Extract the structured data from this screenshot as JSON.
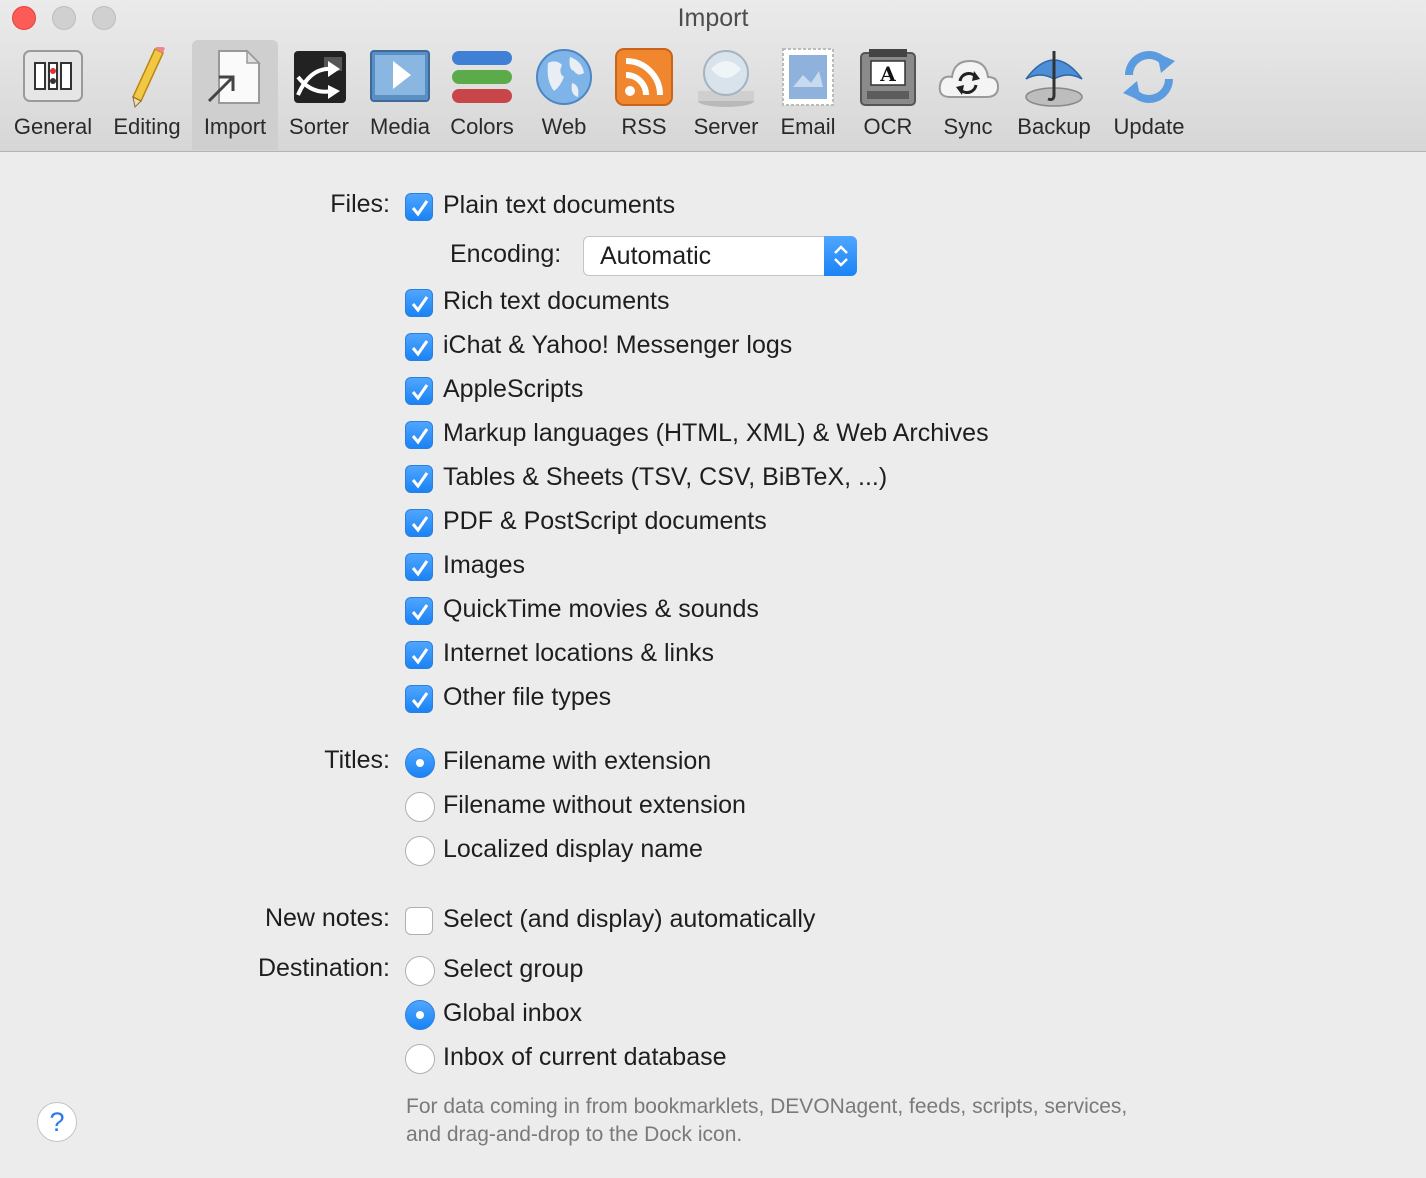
{
  "window": {
    "title": "Import"
  },
  "toolbar": {
    "selected": "Import",
    "items": [
      {
        "label": "General",
        "icon": "general-icon"
      },
      {
        "label": "Editing",
        "icon": "pencil-icon"
      },
      {
        "label": "Import",
        "icon": "import-document-icon"
      },
      {
        "label": "Sorter",
        "icon": "sorter-icon"
      },
      {
        "label": "Media",
        "icon": "media-play-icon"
      },
      {
        "label": "Colors",
        "icon": "colors-icon"
      },
      {
        "label": "Web",
        "icon": "globe-icon"
      },
      {
        "label": "RSS",
        "icon": "rss-icon"
      },
      {
        "label": "Server",
        "icon": "server-icon"
      },
      {
        "label": "Email",
        "icon": "stamp-icon"
      },
      {
        "label": "OCR",
        "icon": "scanner-icon"
      },
      {
        "label": "Sync",
        "icon": "cloud-sync-icon"
      },
      {
        "label": "Backup",
        "icon": "umbrella-icon"
      },
      {
        "label": "Update",
        "icon": "update-arrows-icon"
      }
    ]
  },
  "files": {
    "label": "Files:",
    "plain_text": {
      "label": "Plain text documents",
      "checked": true
    },
    "encoding": {
      "label": "Encoding:",
      "value": "Automatic"
    },
    "options": [
      {
        "label": "Rich text documents",
        "checked": true
      },
      {
        "label": "iChat & Yahoo! Messenger logs",
        "checked": true
      },
      {
        "label": "AppleScripts",
        "checked": true
      },
      {
        "label": "Markup languages (HTML, XML) & Web Archives",
        "checked": true
      },
      {
        "label": "Tables & Sheets (TSV, CSV, BiBTeX, ...)",
        "checked": true
      },
      {
        "label": "PDF & PostScript documents",
        "checked": true
      },
      {
        "label": "Images",
        "checked": true
      },
      {
        "label": "QuickTime movies & sounds",
        "checked": true
      },
      {
        "label": "Internet locations & links",
        "checked": true
      },
      {
        "label": "Other file types",
        "checked": true
      }
    ]
  },
  "titles": {
    "label": "Titles:",
    "options": [
      {
        "label": "Filename with extension",
        "selected": true
      },
      {
        "label": "Filename without extension",
        "selected": false
      },
      {
        "label": "Localized display name",
        "selected": false
      }
    ]
  },
  "new_notes": {
    "label": "New notes:",
    "option": {
      "label": "Select (and display) automatically",
      "checked": false
    }
  },
  "destination": {
    "label": "Destination:",
    "options": [
      {
        "label": "Select group",
        "selected": false
      },
      {
        "label": "Global inbox",
        "selected": true
      },
      {
        "label": "Inbox of current database",
        "selected": false
      }
    ],
    "note": "For data coming in from bookmarklets, DEVONagent, feeds, scripts, services, and drag-and-drop to the Dock icon."
  },
  "help": {
    "label": "?"
  },
  "colors": {
    "accent": "#1a83f5",
    "close": "#fc5b57"
  }
}
